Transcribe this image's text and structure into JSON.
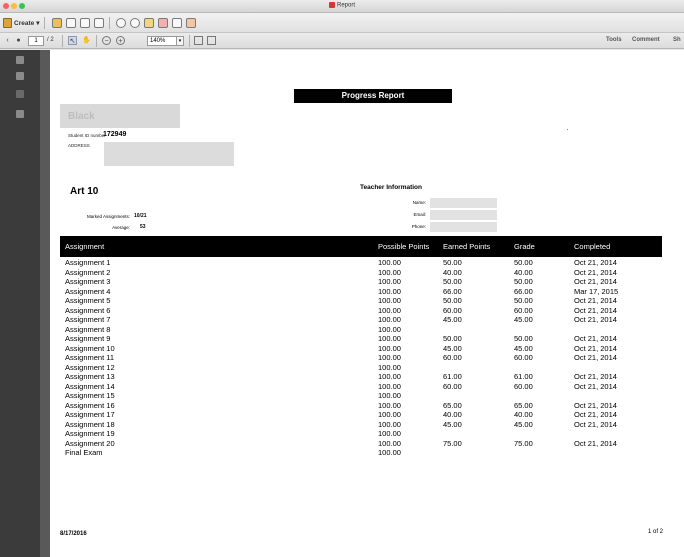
{
  "window": {
    "title": "Report"
  },
  "toolbar": {
    "create_label": "Create"
  },
  "nav": {
    "page_current": "1",
    "page_total": "/ 2",
    "zoom": "140%"
  },
  "right_tabs": [
    "Tools",
    "Comment",
    "Sh"
  ],
  "report": {
    "title": "Progress Report",
    "student_name": "Black",
    "student_id_label": "Student ID number",
    "student_id": "172949",
    "address_label": "ADDRESS",
    "address_value": "",
    "course": "Art 10",
    "teacher_title": "Teacher Information",
    "teacher_labels": [
      "Name:",
      "Email:",
      "Phone:"
    ],
    "marked_label": "Marked Assignments:",
    "marked_value": "10/21",
    "average_label": "Average:",
    "average_value": "53",
    "columns": [
      "Assignment",
      "Possible Points",
      "Earned Points",
      "Grade",
      "Completed"
    ],
    "rows": [
      [
        "Assignment 1",
        "100.00",
        "50.00",
        "50.00",
        "Oct 21, 2014"
      ],
      [
        "Assignment 2",
        "100.00",
        "40.00",
        "40.00",
        "Oct 21, 2014"
      ],
      [
        "Assignment 3",
        "100.00",
        "50.00",
        "50.00",
        "Oct 21, 2014"
      ],
      [
        "Assignment 4",
        "100.00",
        "66.00",
        "66.00",
        "Mar 17, 2015"
      ],
      [
        "Assignment 5",
        "100.00",
        "50.00",
        "50.00",
        "Oct 21, 2014"
      ],
      [
        "Assignment 6",
        "100.00",
        "60.00",
        "60.00",
        "Oct 21, 2014"
      ],
      [
        "Assignment 7",
        "100.00",
        "45.00",
        "45.00",
        "Oct 21, 2014"
      ],
      [
        "Assignment 8",
        "100.00",
        "",
        "",
        ""
      ],
      [
        "Assignment 9",
        "100.00",
        "50.00",
        "50.00",
        "Oct 21, 2014"
      ],
      [
        "Assignment 10",
        "100.00",
        "45.00",
        "45.00",
        "Oct 21, 2014"
      ],
      [
        "Assignment 11",
        "100.00",
        "60.00",
        "60.00",
        "Oct 21, 2014"
      ],
      [
        "Assignment 12",
        "100.00",
        "",
        "",
        ""
      ],
      [
        "Assignment 13",
        "100.00",
        "61.00",
        "61.00",
        "Oct 21, 2014"
      ],
      [
        "Assignment 14",
        "100.00",
        "60.00",
        "60.00",
        "Oct 21, 2014"
      ],
      [
        "Assignment 15",
        "100.00",
        "",
        "",
        ""
      ],
      [
        "Assignment 16",
        "100.00",
        "65.00",
        "65.00",
        "Oct 21, 2014"
      ],
      [
        "Assignment 17",
        "100.00",
        "40.00",
        "40.00",
        "Oct 21, 2014"
      ],
      [
        "Assignment 18",
        "100.00",
        "45.00",
        "45.00",
        "Oct 21, 2014"
      ],
      [
        "Assignment 19",
        "100.00",
        "",
        "",
        ""
      ],
      [
        "Assignment 20",
        "100.00",
        "75.00",
        "75.00",
        "Oct 21, 2014"
      ],
      [
        "Final Exam",
        "100.00",
        "",
        "",
        ""
      ]
    ],
    "footer_date": "8/17/2016",
    "footer_page": "1 of 2"
  }
}
